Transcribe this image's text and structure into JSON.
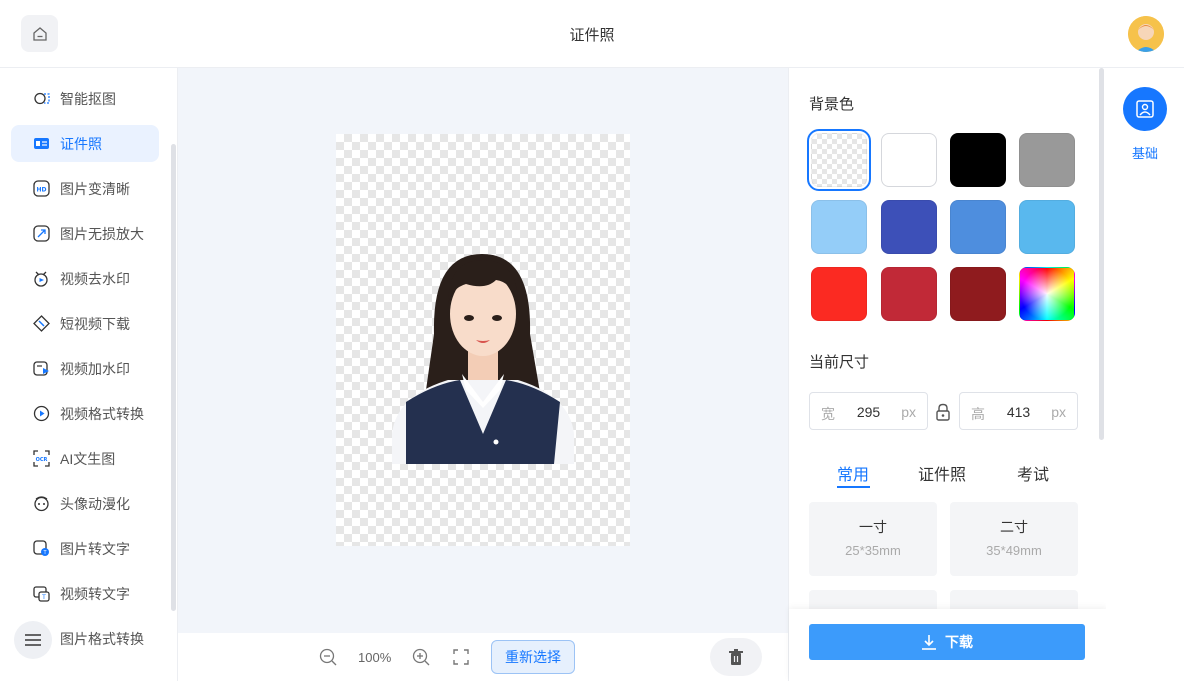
{
  "header": {
    "title": "证件照"
  },
  "sidebar": {
    "items": [
      {
        "label": "智能抠图",
        "icon": "cutout-icon",
        "active": false
      },
      {
        "label": "证件照",
        "icon": "id-photo-icon",
        "active": true
      },
      {
        "label": "图片变清晰",
        "icon": "hd-icon",
        "active": false
      },
      {
        "label": "图片无损放大",
        "icon": "enlarge-icon",
        "active": false
      },
      {
        "label": "视频去水印",
        "icon": "video-watermark-remove-icon",
        "active": false
      },
      {
        "label": "短视频下载",
        "icon": "video-download-icon",
        "active": false
      },
      {
        "label": "视频加水印",
        "icon": "video-add-watermark-icon",
        "active": false
      },
      {
        "label": "视频格式转换",
        "icon": "video-convert-icon",
        "active": false
      },
      {
        "label": "AI文生图",
        "icon": "ai-image-icon",
        "active": false
      },
      {
        "label": "头像动漫化",
        "icon": "anime-avatar-icon",
        "active": false
      },
      {
        "label": "图片转文字",
        "icon": "image-to-text-icon",
        "active": false
      },
      {
        "label": "视频转文字",
        "icon": "video-to-text-icon",
        "active": false
      },
      {
        "label": "图片格式转换",
        "icon": "image-convert-icon",
        "active": false
      }
    ]
  },
  "toolbar": {
    "zoom": "100%",
    "reselect_label": "重新选择"
  },
  "panel": {
    "bg_title": "背景色",
    "colors": [
      {
        "name": "transparent",
        "hex": "transparent",
        "selected": true
      },
      {
        "name": "white",
        "hex": "#ffffff",
        "selected": false
      },
      {
        "name": "black",
        "hex": "#000000",
        "selected": false
      },
      {
        "name": "gray",
        "hex": "#999999",
        "selected": false
      },
      {
        "name": "light-blue",
        "hex": "#94cdf8",
        "selected": false
      },
      {
        "name": "indigo",
        "hex": "#3d50b8",
        "selected": false
      },
      {
        "name": "blue",
        "hex": "#4e8ede",
        "selected": false
      },
      {
        "name": "sky-blue",
        "hex": "#59b8ee",
        "selected": false
      },
      {
        "name": "red",
        "hex": "#fb2a22",
        "selected": false
      },
      {
        "name": "crimson",
        "hex": "#c12937",
        "selected": false
      },
      {
        "name": "dark-red",
        "hex": "#8f1b1e",
        "selected": false
      },
      {
        "name": "custom",
        "hex": "rainbow",
        "selected": false
      }
    ],
    "size_title": "当前尺寸",
    "width_label": "宽",
    "width_value": "295",
    "height_label": "高",
    "height_value": "413",
    "unit": "px",
    "tabs": [
      {
        "label": "常用",
        "active": true
      },
      {
        "label": "证件照",
        "active": false
      },
      {
        "label": "考试",
        "active": false
      }
    ],
    "sizes": [
      {
        "name": "一寸",
        "dim": "25*35mm"
      },
      {
        "name": "二寸",
        "dim": "35*49mm"
      }
    ],
    "download_label": "下载"
  },
  "rightbar": {
    "basic_label": "基础"
  }
}
